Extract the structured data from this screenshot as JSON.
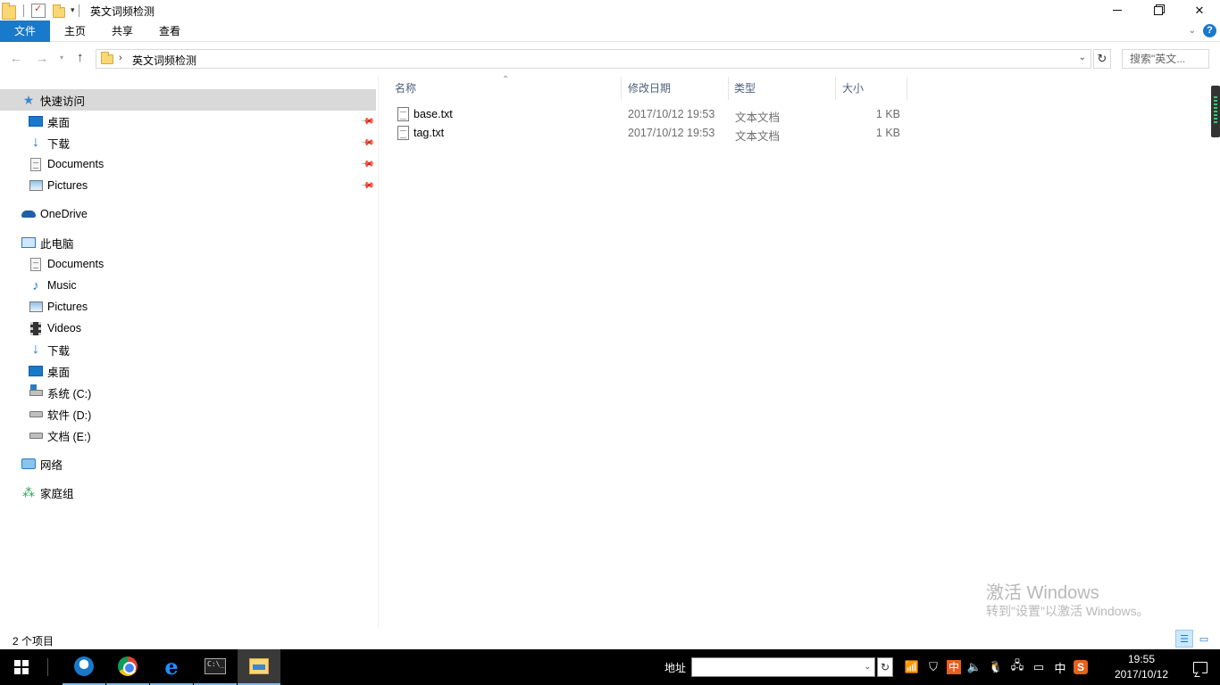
{
  "window": {
    "title": "英文词频检测",
    "controls": {
      "minimize": "—",
      "maximize": "❐",
      "close": "✕"
    }
  },
  "ribbon": {
    "tabs": [
      {
        "label": "文件",
        "active": true
      },
      {
        "label": "主页"
      },
      {
        "label": "共享"
      },
      {
        "label": "查看"
      }
    ],
    "accent": "#1979ca"
  },
  "address": {
    "path": [
      "英文词频检测"
    ],
    "separator": "›",
    "search_placeholder": "搜索\"英文..."
  },
  "nav": {
    "quick_access": {
      "label": "快速访问",
      "items": [
        {
          "label": "桌面",
          "icon": "desktop-icon",
          "pinned": true
        },
        {
          "label": "下载",
          "icon": "download-icon",
          "pinned": true
        },
        {
          "label": "Documents",
          "icon": "documents-icon",
          "pinned": true
        },
        {
          "label": "Pictures",
          "icon": "pictures-icon",
          "pinned": true
        }
      ]
    },
    "onedrive": {
      "label": "OneDrive"
    },
    "this_pc": {
      "label": "此电脑",
      "items": [
        {
          "label": "Documents",
          "icon": "documents-icon"
        },
        {
          "label": "Music",
          "icon": "music-icon"
        },
        {
          "label": "Pictures",
          "icon": "pictures-icon"
        },
        {
          "label": "Videos",
          "icon": "videos-icon"
        },
        {
          "label": "下载",
          "icon": "download-icon"
        },
        {
          "label": "桌面",
          "icon": "desktop-icon"
        },
        {
          "label": "系统 (C:)",
          "icon": "system-drive-icon"
        },
        {
          "label": "软件 (D:)",
          "icon": "drive-icon"
        },
        {
          "label": "文档 (E:)",
          "icon": "drive-icon"
        }
      ]
    },
    "network": {
      "label": "网络"
    },
    "homegroup": {
      "label": "家庭组"
    }
  },
  "files": {
    "columns": {
      "name": "名称",
      "date": "修改日期",
      "type": "类型",
      "size": "大小"
    },
    "rows": [
      {
        "name": "base.txt",
        "date": "2017/10/12 19:53",
        "type": "文本文档",
        "size": "1 KB"
      },
      {
        "name": "tag.txt",
        "date": "2017/10/12 19:53",
        "type": "文本文档",
        "size": "1 KB"
      }
    ]
  },
  "watermark": {
    "line1": "激活 Windows",
    "line2": "转到\"设置\"以激活 Windows。"
  },
  "status": {
    "count": "2 个项目"
  },
  "taskbar": {
    "apps": [
      "qq-icon",
      "chrome-icon",
      "edge-icon",
      "cmd-icon",
      "file-explorer-icon"
    ],
    "address_label": "地址",
    "address_value": "",
    "tray": {
      "ime_badge": "中",
      "ime_text": "中",
      "sogou": "S"
    },
    "clock": {
      "time": "19:55",
      "date": "2017/10/12"
    }
  }
}
